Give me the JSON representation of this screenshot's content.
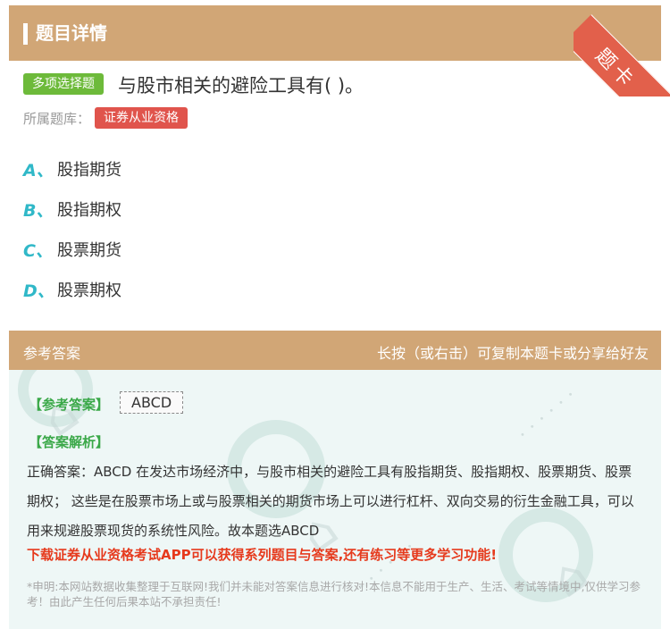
{
  "header": {
    "title": "题目详情",
    "ribbon_label": "题卡"
  },
  "question": {
    "type_tag": "多项选择题",
    "stem": "与股市相关的避险工具有( )。",
    "bank_label": "所属题库：",
    "bank_tag": "证券从业资格",
    "options": [
      {
        "letter": "A、",
        "text": "股指期货"
      },
      {
        "letter": "B、",
        "text": "股指期权"
      },
      {
        "letter": "C、",
        "text": "股票期货"
      },
      {
        "letter": "D、",
        "text": "股票期权"
      }
    ]
  },
  "answer_section": {
    "title": "参考答案",
    "hint": "长按（或右击）可复制本题卡或分享给好友",
    "ref_label": "【参考答案】",
    "ref_value": "ABCD",
    "analysis_label": "【答案解析】",
    "analysis_text": "正确答案：ABCD 在发达市场经济中，与股市相关的避险工具有股指期货、股指期权、股票期货、股票期权； 这些是在股票市场上或与股票相关的期货市场上可以进行杠杆、双向交易的衍生金融工具，可以用来规避股票现货的系统性风险。故本题选ABCD",
    "promo": "下载证券从业资格考试APP可以获得系列题目与答案,还有练习等更多学习功能!",
    "disclaimer": "*申明:本网站数据收集整理于互联网!我们并未能对答案信息进行核对!本信息不能用于生产、生活、考试等情境中,仅供学习参考！由此产生任何后果本站不承担责任!"
  },
  "colors": {
    "header_bg": "#d1a676",
    "type_tag_bg": "#6dba3a",
    "bank_tag_bg": "#e0544c",
    "option_letter": "#30b8c8",
    "answer_body_bg": "#eef7f6",
    "promo_text": "#e63a1d"
  }
}
